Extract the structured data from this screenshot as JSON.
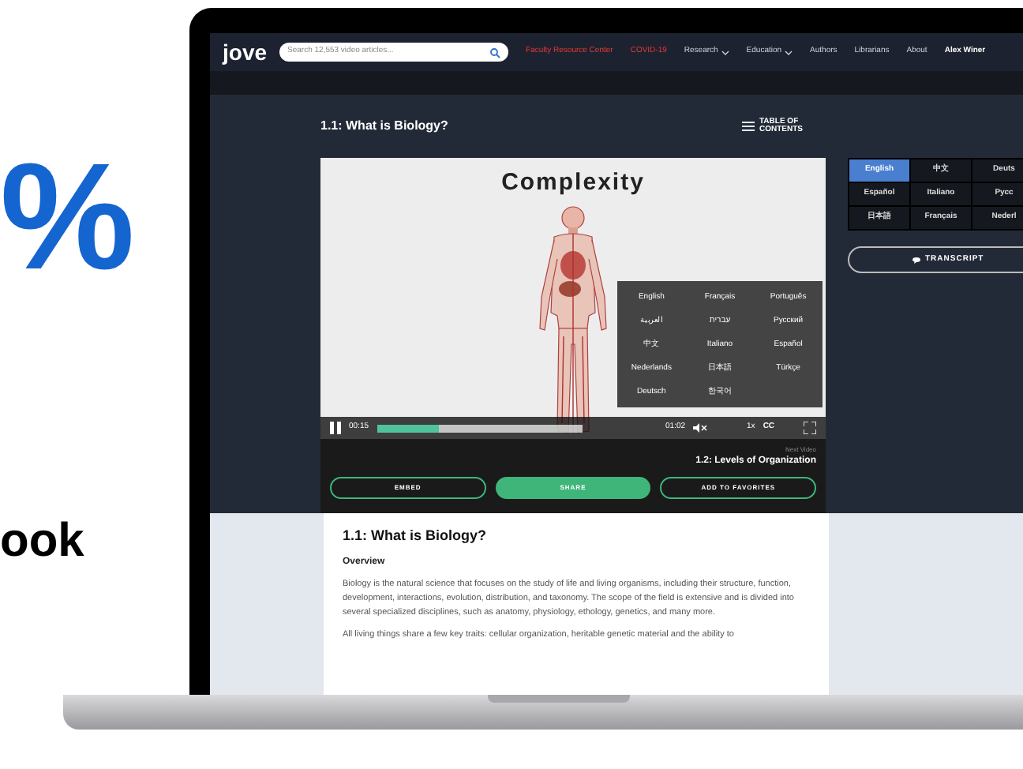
{
  "marketing": {
    "headline_fragment": "%",
    "subline_fragment": "ook"
  },
  "nav": {
    "logo": "jove",
    "search_placeholder": "Search 12,553 video articles...",
    "links": [
      {
        "label": "Faculty Resource Center",
        "kind": "alert"
      },
      {
        "label": "COVID-19",
        "kind": "alert"
      },
      {
        "label": "Research",
        "kind": "dropdown"
      },
      {
        "label": "Education",
        "kind": "dropdown"
      },
      {
        "label": "Authors",
        "kind": "link"
      },
      {
        "label": "Librarians",
        "kind": "link"
      },
      {
        "label": "About",
        "kind": "link"
      }
    ],
    "user": "Alex Winer"
  },
  "lesson": {
    "title": "1.1: What is Biology?",
    "toc_label": "TABLE OF CONTENTS"
  },
  "video": {
    "slide_title": "Complexity",
    "languages": [
      "English",
      "Français",
      "Português",
      "العربية",
      "עברית",
      "Русский",
      "中文",
      "Italiano",
      "Español",
      "Nederlands",
      "日本語",
      "Türkçe",
      "Deutsch",
      "한국어"
    ],
    "current_time": "00:15",
    "duration": "01:02",
    "level": 0.3,
    "speed": "1x",
    "captions": "CC"
  },
  "next_video": {
    "label": "Next Video",
    "title": "1.2: Levels of Organization"
  },
  "actions": [
    {
      "label": "EMBED",
      "kind": "outline"
    },
    {
      "label": "SHARE",
      "kind": "primary"
    },
    {
      "label": "ADD TO FAVORITES",
      "kind": "outline"
    }
  ],
  "transcript_languages": [
    {
      "label": "English",
      "selected": true
    },
    {
      "label": "中文",
      "selected": false
    },
    {
      "label": "Deuts",
      "selected": false
    },
    {
      "label": "Español",
      "selected": false
    },
    {
      "label": "Italiano",
      "selected": false
    },
    {
      "label": "Русс",
      "selected": false
    },
    {
      "label": "日本語",
      "selected": false
    },
    {
      "label": "Français",
      "selected": false
    },
    {
      "label": "Nederl",
      "selected": false
    }
  ],
  "transcript_button": "TRANSCRIPT",
  "article": {
    "title": "1.1: What is Biology?",
    "heading": "Overview",
    "paragraphs": [
      "Biology is the natural science that focuses on the study of life and living organisms, including their structure, function, development, interactions, evolution, distribution, and taxonomy. The scope of the field is extensive and is divided into several specialized disciplines, such as anatomy, physiology, ethology, genetics, and many more.",
      "All living things share a few key traits: cellular organization, heritable genetic material and the ability to"
    ]
  }
}
